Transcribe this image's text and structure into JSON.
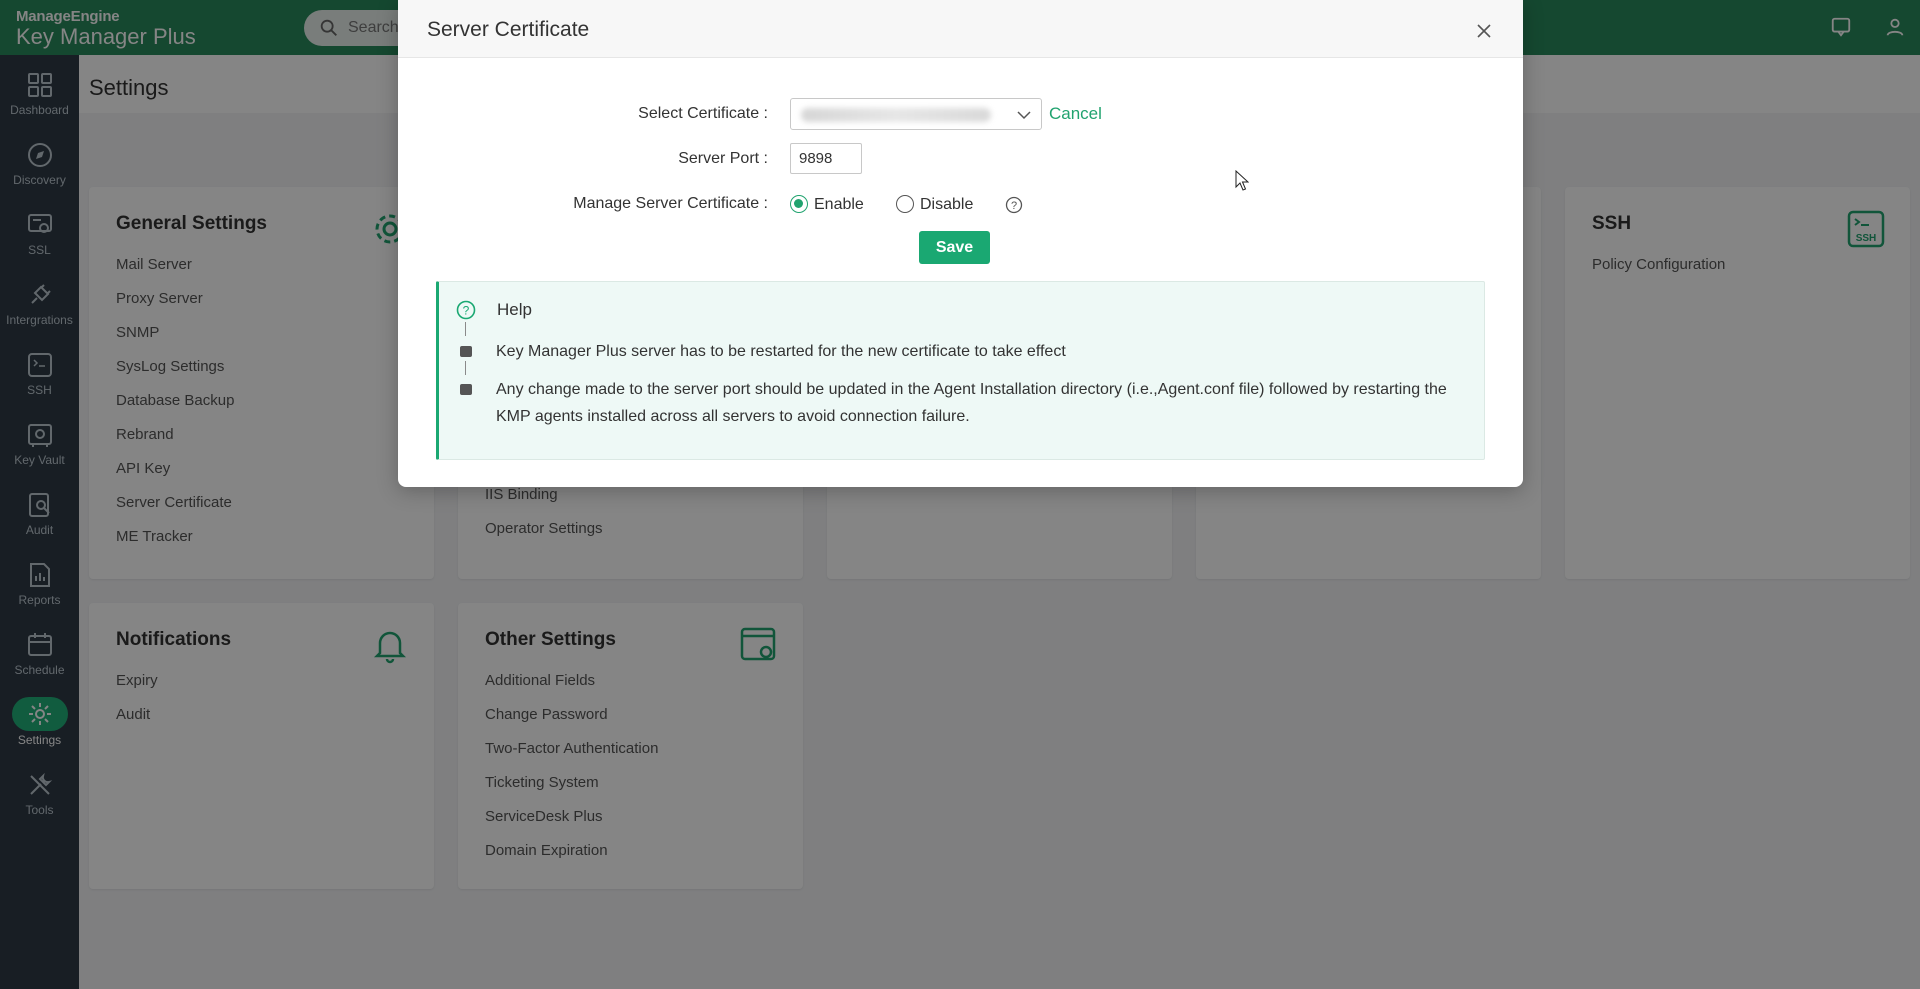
{
  "brand": {
    "company": "ManageEngine",
    "product": "Key Manager Plus"
  },
  "search": {
    "placeholder": "Search"
  },
  "sidebar": {
    "items": [
      {
        "label": "Dashboard",
        "icon": "dashboard-icon"
      },
      {
        "label": "Discovery",
        "icon": "compass-icon"
      },
      {
        "label": "SSL",
        "icon": "ssl-certificate-icon"
      },
      {
        "label": "Intergrations",
        "icon": "plug-icon"
      },
      {
        "label": "SSH",
        "icon": "ssh-icon"
      },
      {
        "label": "Key Vault",
        "icon": "vault-icon"
      },
      {
        "label": "Audit",
        "icon": "audit-icon"
      },
      {
        "label": "Reports",
        "icon": "reports-icon"
      },
      {
        "label": "Schedule",
        "icon": "calendar-icon"
      },
      {
        "label": "Settings",
        "icon": "gear-icon",
        "active": true
      },
      {
        "label": "Tools",
        "icon": "tools-icon"
      }
    ]
  },
  "page": {
    "title": "Settings"
  },
  "cards": {
    "general": {
      "title": "General Settings",
      "items": [
        "Mail Server",
        "Proxy Server",
        "SNMP",
        "SysLog Settings",
        "Database Backup",
        "Rebrand",
        "API Key",
        "Server Certificate",
        "ME Tracker"
      ]
    },
    "second": {
      "items": [
        "IIS Binding",
        "Operator Settings"
      ]
    },
    "ssh": {
      "title": "SSH",
      "items": [
        "Policy Configuration"
      ],
      "icon_text": "SSH"
    },
    "notifications": {
      "title": "Notifications",
      "items": [
        "Expiry",
        "Audit"
      ]
    },
    "other": {
      "title": "Other Settings",
      "items": [
        "Additional Fields",
        "Change Password",
        "Two-Factor Authentication",
        "Ticketing System",
        "ServiceDesk Plus",
        "Domain Expiration"
      ]
    }
  },
  "modal": {
    "title": "Server Certificate",
    "labels": {
      "select_certificate": "Select Certificate :",
      "server_port": "Server Port :",
      "manage_certificate": "Manage Server Certificate :"
    },
    "cancel": "Cancel",
    "server_port_value": "9898",
    "radio": {
      "enable": "Enable",
      "disable": "Disable",
      "selected": "Enable"
    },
    "save": "Save",
    "help": {
      "title": "Help",
      "notes": [
        "Key Manager Plus server has to be restarted for the new certificate to take effect",
        "Any change made to the server port should be updated in the Agent Installation directory (i.e.,Agent.conf file) followed by restarting the KMP agents installed across all servers to avoid connection failure."
      ]
    }
  },
  "colors": {
    "brand_green": "#2a8a5c",
    "accent": "#1aa872",
    "sidebar": "#2f3b46"
  }
}
